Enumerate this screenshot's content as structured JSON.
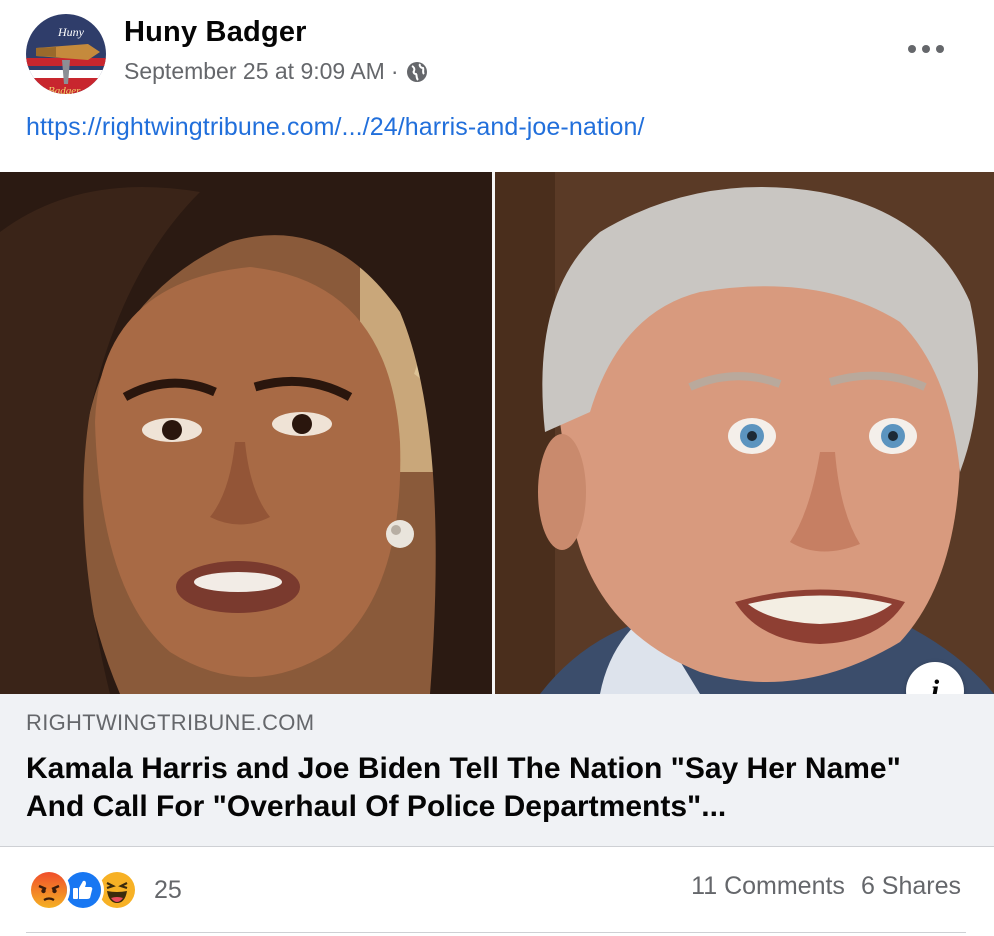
{
  "post": {
    "author": "Huny Badger",
    "timestamp": "September 25 at 9:09 AM",
    "separator": "·",
    "privacy_icon": "globe-icon",
    "more_icon": "more-options-icon",
    "link_text": "https://rightwingtribune.com/.../24/harris-and-joe-nation/",
    "avatar_text": {
      "top": "Huny",
      "bottom": "Badger"
    }
  },
  "link_preview": {
    "domain": "RIGHTWINGTRIBUNE.COM",
    "headline": "Kamala Harris and Joe Biden Tell The Nation \"Say Her Name\" And Call For \"Overhaul Of Police Departments\"...",
    "info_label": "i"
  },
  "engagement": {
    "reaction_icons": [
      "angry-reaction-icon",
      "like-reaction-icon",
      "haha-reaction-icon"
    ],
    "reaction_count": "25",
    "comments": "11 Comments",
    "shares": "6 Shares"
  },
  "colors": {
    "link": "#216fdb",
    "secondary_text": "#65676b",
    "preview_bg": "#f0f2f5",
    "like_blue": "#1877f2",
    "angry_orange": "#e9710f",
    "haha_yellow": "#f7b125"
  }
}
